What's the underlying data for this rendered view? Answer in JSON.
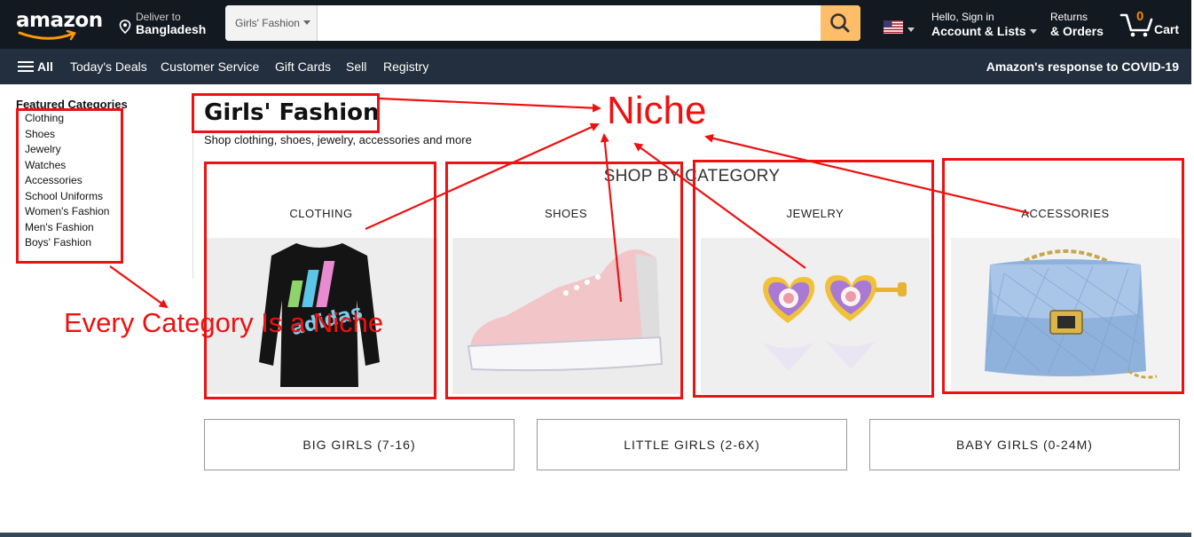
{
  "header": {
    "logo_text": "amazon",
    "deliver_line1": "Deliver to",
    "deliver_line2": "Bangladesh",
    "search_category": "Girls' Fashion",
    "search_placeholder": "",
    "account_line1": "Hello, Sign in",
    "account_line2": "Account & Lists",
    "returns_line1": "Returns",
    "returns_line2": "& Orders",
    "cart_count": "0",
    "cart_label": "Cart"
  },
  "subnav": {
    "all_label": "All",
    "links": [
      "Today's Deals",
      "Customer Service",
      "Gift Cards",
      "Sell",
      "Registry"
    ],
    "covid_label": "Amazon's response to COVID-19"
  },
  "sidebar": {
    "heading": "Featured Categories",
    "items": [
      "Clothing",
      "Shoes",
      "Jewelry",
      "Watches",
      "Accessories",
      "School Uniforms",
      "Women's Fashion",
      "Men's Fashion",
      "Boys' Fashion"
    ]
  },
  "main": {
    "title": "Girls' Fashion",
    "subtitle": "Shop clothing, shoes, jewelry, accessories and more",
    "shop_by_heading": "SHOP BY CATEGORY",
    "categories": [
      "CLOTHING",
      "SHOES",
      "JEWELRY",
      "ACCESSORIES"
    ],
    "subcategories": [
      "BIG GIRLS (7-16)",
      "LITTLE GIRLS (2-6X)",
      "BABY GIRLS (0-24M)"
    ]
  },
  "annotations": {
    "niche_label": "Niche",
    "every_category_label": "Every Category Is a Niche",
    "color": "#e11111"
  },
  "colors": {
    "nav_top": "#131921",
    "nav_sub": "#232f3e",
    "search_button": "#febd69",
    "cart_count": "#f08804"
  }
}
